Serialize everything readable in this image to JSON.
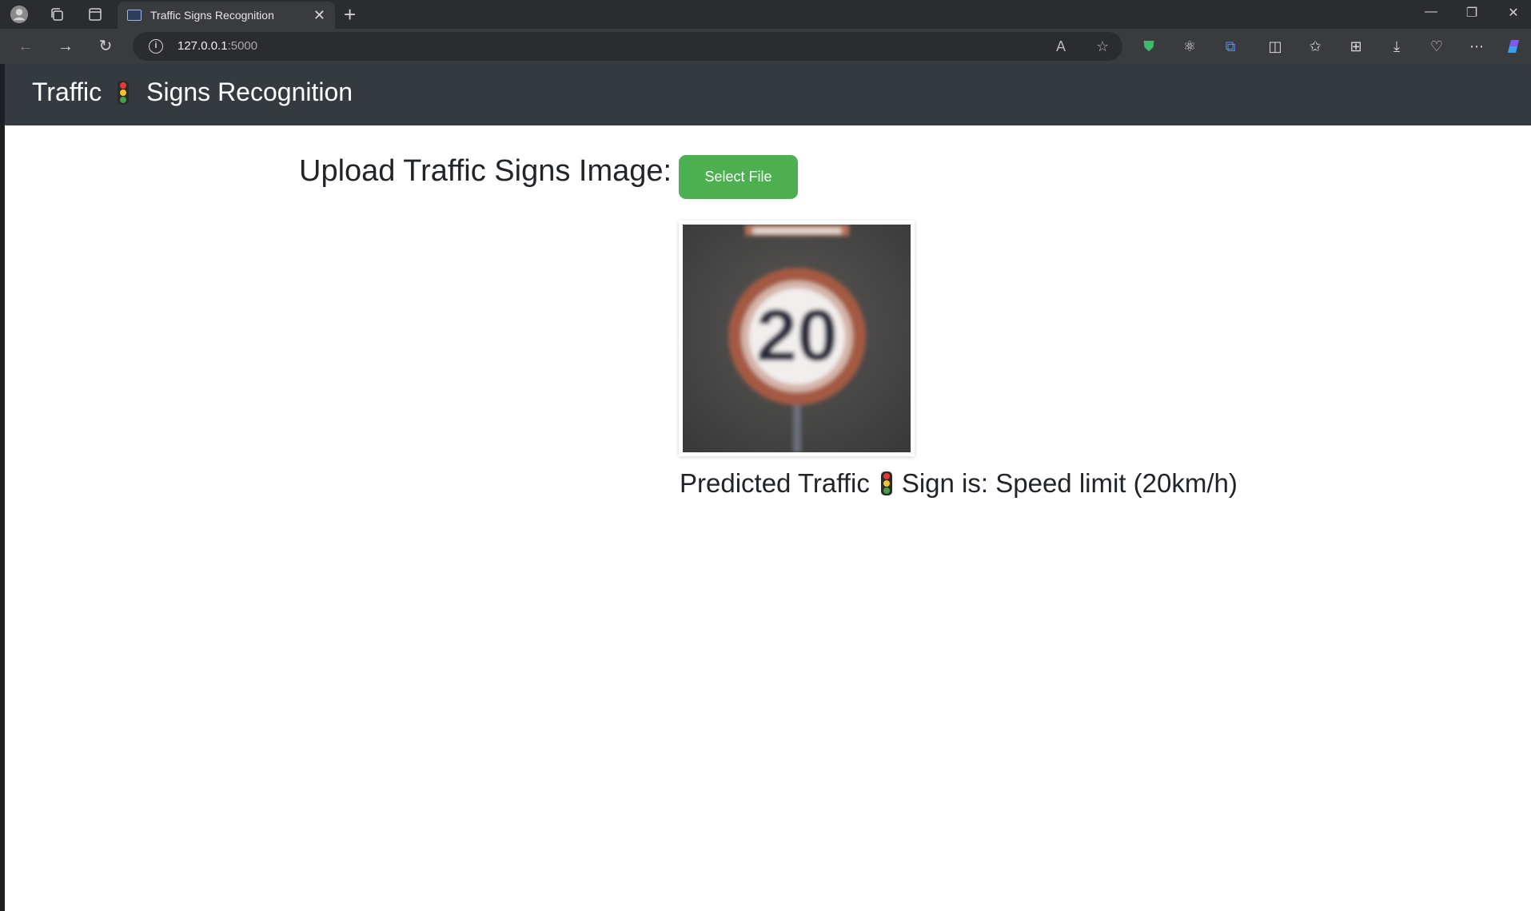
{
  "browser": {
    "tab_title": "Traffic Signs Recognition",
    "url_host": "127.0.0.1",
    "url_port": ":5000",
    "icons": [
      "profile-icon",
      "collections-icon",
      "tab-actions-icon",
      "back-icon",
      "forward-icon",
      "refresh-icon",
      "info-icon",
      "read-aloud-icon",
      "favorite-star-icon",
      "shield-icon",
      "extension-icon",
      "translate-icon",
      "split-screen-icon",
      "favorites-icon",
      "collections-icon",
      "download-icon",
      "performance-icon",
      "more-icon",
      "copilot-icon"
    ]
  },
  "navbar": {
    "brand_part1": "Traffic",
    "brand_part2": "Signs Recognition"
  },
  "upload": {
    "label": "Upload Traffic Signs Image:",
    "button_label": "Select File"
  },
  "result": {
    "prefix": "Predicted Traffic",
    "suffix": "Sign is: Speed limit (20km/h)",
    "image_sign_text": "20"
  },
  "colors": {
    "navbar_bg": "#343a40",
    "button_bg": "#4caf50",
    "text": "#212529"
  }
}
